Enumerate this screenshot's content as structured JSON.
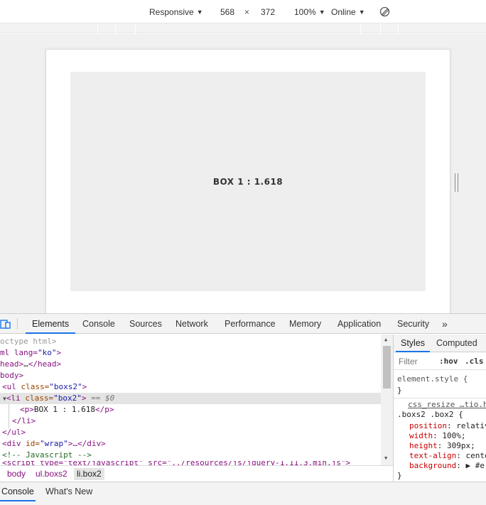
{
  "device_toolbar": {
    "device": "Responsive",
    "width": "568",
    "times": "×",
    "height": "372",
    "zoom": "100%",
    "throttling": "Online",
    "caret": "▼"
  },
  "page": {
    "box_text": "BOX 1 : 1.618"
  },
  "devtools": {
    "tabs": [
      "Elements",
      "Console",
      "Sources",
      "Network",
      "Performance",
      "Memory",
      "Application",
      "Security"
    ],
    "more": "»",
    "elements": {
      "l1": "octype html>",
      "l2_tag": "ml lang=",
      "l2_val": "\"ko\"",
      "l2_end": ">",
      "l3_tag": "head>",
      "l3_mid": "…",
      "l3_end": "</head>",
      "l4": "body>",
      "l5_open": "<ul ",
      "l5_attr": "class=",
      "l5_val": "\"boxs2\"",
      "l5_end": ">",
      "l6_arrow": "▼",
      "l6_open": "<li ",
      "l6_attr": "class=",
      "l6_val": "\"box2\"",
      "l6_end": ">",
      "l6_eq": " == $0",
      "l7_open": "<p>",
      "l7_text": "BOX 1 : 1.618",
      "l7_end": "</p>",
      "l8": "</li>",
      "l9": "</ul>",
      "l10_open": "<div ",
      "l10_attr": "id=",
      "l10_val": "\"wrap\"",
      "l10_mid": ">…",
      "l10_end": "</div>",
      "l11": "<!-- Javascript -->",
      "l12": "<script type=\"text/javascript\" src=\"../resources/js/jquery-1.11.3.min.js\">"
    },
    "breadcrumb": [
      "body",
      "ul.boxs2",
      "li.box2"
    ],
    "styles": {
      "tabs": [
        "Styles",
        "Computed"
      ],
      "filter_placeholder": "Filter",
      "hov": ":hov",
      "cls": ".cls",
      "element_style": "element.style {",
      "close_brace": "}",
      "source_link": "css_resize …tio.h",
      "selector": ".boxs2 .box2 {",
      "props": [
        {
          "name": "position",
          "value": "relativ"
        },
        {
          "name": "width",
          "value": "100%;"
        },
        {
          "name": "height",
          "value": "309px;"
        },
        {
          "name": "text-align",
          "value": "cente"
        },
        {
          "name": "background",
          "value": "▶ #e"
        }
      ]
    },
    "drawer_tabs": [
      "Console",
      "What's New"
    ]
  },
  "colors": {
    "accent": "#1a73e8",
    "tag": "#881280",
    "attr": "#994500",
    "attr_value": "#1a1aa6",
    "comment": "#236e25",
    "box_bg": "#eeeeee"
  }
}
